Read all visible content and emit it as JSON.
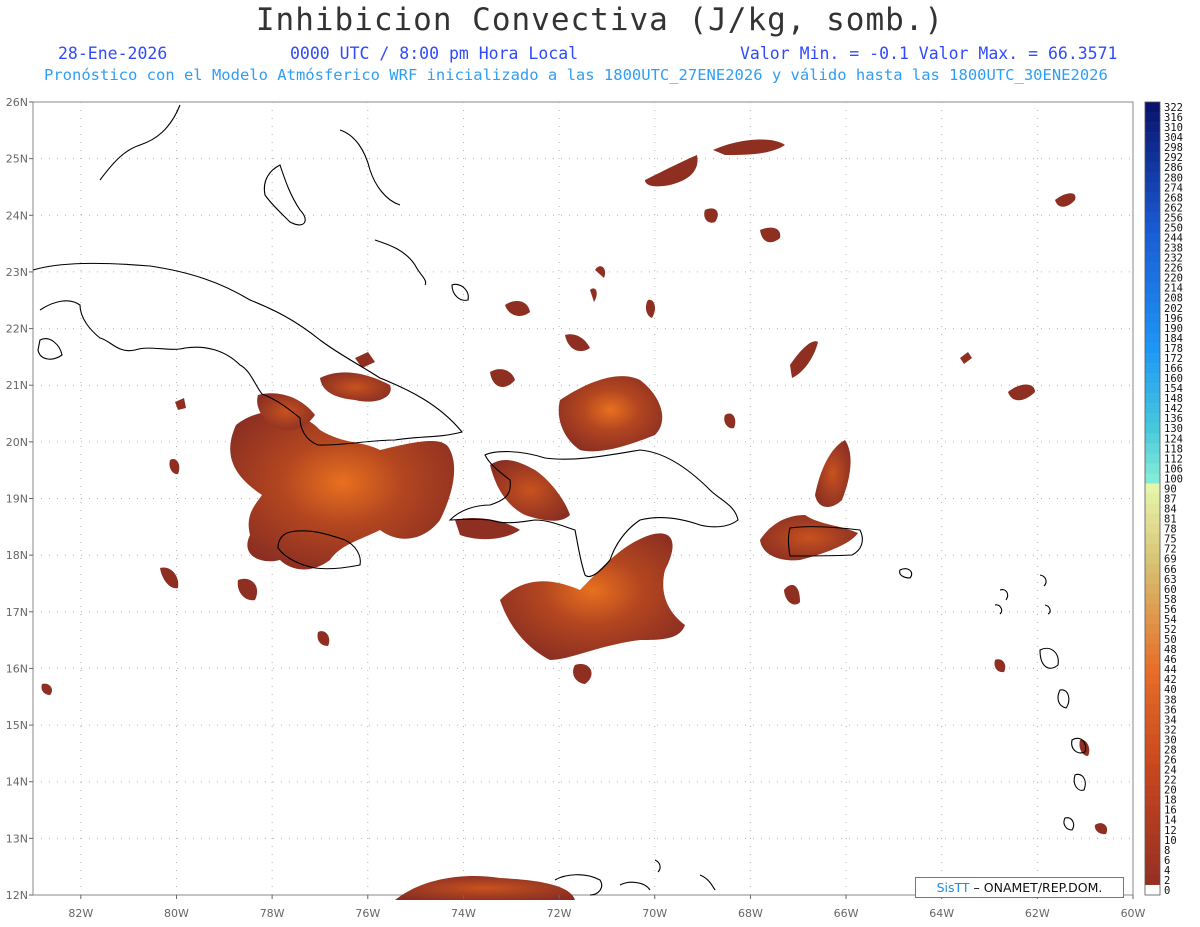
{
  "header": {
    "title": "Inhibicion Convectiva (J/kg, somb.)",
    "date": "28-Ene-2026",
    "time": "0000 UTC / 8:00 pm Hora Local",
    "minmax": "Valor Min. = -0.1  Valor Max. = 66.3571",
    "subtitle": "Pronóstico con el Modelo Atmósferico WRF inicializado a las 1800UTC_27ENE2026 y válido hasta las  1800UTC_30ENE2026"
  },
  "map": {
    "lat_labels": [
      "26N",
      "25N",
      "24N",
      "23N",
      "22N",
      "21N",
      "20N",
      "19N",
      "18N",
      "17N",
      "16N",
      "15N",
      "14N",
      "13N",
      "12N"
    ],
    "lon_labels": [
      "82W",
      "80W",
      "78W",
      "76W",
      "74W",
      "72W",
      "70W",
      "68W",
      "66W",
      "64W",
      "62W",
      "60W"
    ],
    "lat_range": [
      12,
      26
    ],
    "lon_range": [
      -83,
      -60
    ],
    "field_color": "#8f2f22",
    "field_highlight": "#e0641f",
    "coast_color": "#000000",
    "grid": "dotted"
  },
  "colorbar": {
    "labels": [
      "322",
      "316",
      "310",
      "304",
      "298",
      "292",
      "286",
      "280",
      "274",
      "268",
      "262",
      "256",
      "250",
      "244",
      "238",
      "232",
      "226",
      "220",
      "214",
      "208",
      "202",
      "196",
      "190",
      "184",
      "178",
      "172",
      "166",
      "160",
      "154",
      "148",
      "142",
      "136",
      "130",
      "124",
      "118",
      "112",
      "106",
      "100",
      "90",
      "87",
      "84",
      "81",
      "78",
      "75",
      "72",
      "69",
      "66",
      "63",
      "60",
      "58",
      "56",
      "54",
      "52",
      "50",
      "48",
      "46",
      "44",
      "42",
      "40",
      "38",
      "36",
      "34",
      "32",
      "30",
      "28",
      "26",
      "24",
      "22",
      "20",
      "18",
      "16",
      "14",
      "12",
      "10",
      "8",
      "6",
      "4",
      "2",
      "0"
    ]
  },
  "credit": {
    "brand": "SisTT",
    "text": " – ONAMET/REP.DOM."
  }
}
